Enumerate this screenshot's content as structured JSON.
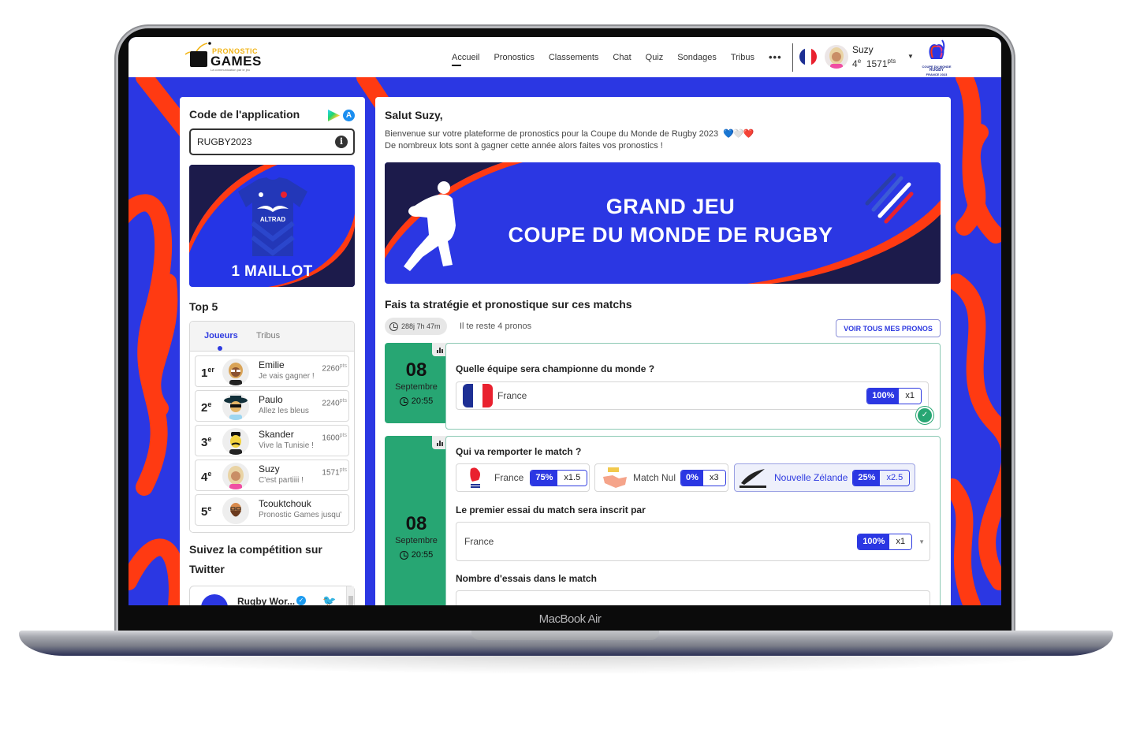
{
  "device": {
    "label": "MacBook Air"
  },
  "header": {
    "logo": {
      "line1": "PRONOSTIC",
      "line2": "GAMES",
      "tagline": "La communication par le jeu"
    },
    "nav": [
      {
        "label": "Accueil",
        "active": true
      },
      {
        "label": "Pronostics"
      },
      {
        "label": "Classements"
      },
      {
        "label": "Chat"
      },
      {
        "label": "Quiz"
      },
      {
        "label": "Sondages"
      },
      {
        "label": "Tribus"
      }
    ],
    "more_icon": "•••",
    "language_flag": "France",
    "user": {
      "name": "Suzy",
      "rank": "4",
      "rank_suffix": "e",
      "points": "1571",
      "points_unit": "pts"
    },
    "event_logo": {
      "line1": "COUPE DU MONDE",
      "line2": "RUGBY",
      "line3": "FRANCE 2023"
    }
  },
  "sidebar": {
    "app_code": {
      "title": "Code de l'application",
      "value": "RUGBY2023",
      "info_icon": "i"
    },
    "prize": {
      "label": "1 MAILLOT",
      "sponsor": "ALTRAD"
    },
    "top5": {
      "title": "Top 5",
      "tabs": [
        {
          "label": "Joueurs",
          "active": true
        },
        {
          "label": "Tribus"
        }
      ],
      "rows": [
        {
          "pos": "1",
          "suffix": "er",
          "name": "Emilie",
          "message": "Je vais gagner !",
          "points": "2260",
          "unit": "pts"
        },
        {
          "pos": "2",
          "suffix": "e",
          "name": "Paulo",
          "message": "Allez les bleus",
          "points": "2240",
          "unit": "pts"
        },
        {
          "pos": "3",
          "suffix": "e",
          "name": "Skander",
          "message": "Vive la Tunisie !",
          "points": "1600",
          "unit": "pts"
        },
        {
          "pos": "4",
          "suffix": "e",
          "name": "Suzy",
          "message": "C'est partiiii !",
          "points": "1571",
          "unit": "pts"
        },
        {
          "pos": "5",
          "suffix": "e",
          "name": "Tcouktchouk",
          "message": "Pronostic Games jusqu'",
          "points": "",
          "unit": ""
        }
      ]
    },
    "twitter": {
      "title": "Suivez la compétition sur Twitter",
      "account": "Rugby Wor..."
    }
  },
  "main": {
    "greeting": "Salut Suzy,",
    "intro_line1": "Bienvenue sur votre plateforme de pronostics pour la Coupe du Monde de Rugby 2023",
    "intro_hearts": "💙🤍❤️",
    "intro_line2": "De nombreux lots sont à gagner cette année alors faites vos pronostics !",
    "banner": {
      "line1": "GRAND JEU",
      "line2": "COUPE DU MONDE DE RUGBY"
    },
    "section_title": "Fais ta stratégie et pronostique sur ces matchs",
    "countdown": "288j 7h 47m",
    "remaining": "Il te reste 4 pronos",
    "all_pronos_button": "VOIR TOUS MES PRONOS",
    "matches": [
      {
        "day": "08",
        "month": "Septembre",
        "time": "20:55",
        "questions": [
          {
            "label": "Quelle équipe sera championne du monde ?",
            "choices": [
              {
                "label": "France",
                "pct": "100%",
                "mult": "x1"
              }
            ],
            "validated": true
          }
        ]
      },
      {
        "day": "08",
        "month": "Septembre",
        "time": "20:55",
        "questions": [
          {
            "label": "Qui va remporter le match ?",
            "choices": [
              {
                "label": "France",
                "pct": "75%",
                "mult": "x1.5"
              },
              {
                "label": "Match Nul",
                "pct": "0%",
                "mult": "x3",
                "badge": "DRAW"
              },
              {
                "label": "Nouvelle Zélande",
                "pct": "25%",
                "mult": "x2.5",
                "selected": true,
                "badge": "ALL BLACKS"
              }
            ]
          },
          {
            "label": "Le premier essai du match sera inscrit par",
            "select": {
              "value": "France",
              "pct": "100%",
              "mult": "x1"
            }
          },
          {
            "label": "Nombre d'essais dans le match"
          }
        ]
      }
    ]
  },
  "colors": {
    "brand_blue": "#2b37e3",
    "accent_red": "#ff3a12",
    "success_green": "#27a673",
    "navy": "#1c1b4b"
  }
}
